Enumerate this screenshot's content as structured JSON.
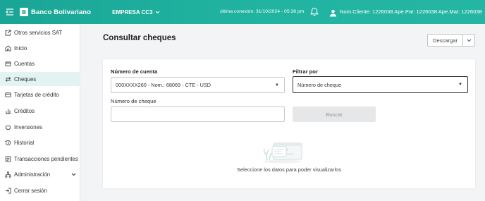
{
  "header": {
    "brand_initial": "B",
    "brand": "Banco Bolivariano",
    "company": "EMPRESA CC3",
    "last_connection": "última conexión: 31/10/2024 - 05:38 pm",
    "user_info": "Nom.Cliente: 1226038 Ape.Pat: 1226038 Ape.Mat: 1226038",
    "colors": {
      "accent": "#1aa596",
      "active_bg": "#e3f3f1"
    }
  },
  "sidebar": {
    "items": [
      {
        "label": "Otros servicios SAT",
        "icon": "external-link-icon"
      },
      {
        "label": "Inicio",
        "icon": "home-icon"
      },
      {
        "label": "Cuentas",
        "icon": "wallet-icon"
      },
      {
        "label": "Cheques",
        "icon": "transfer-arrows-icon",
        "active": true
      },
      {
        "label": "Tarjetas de crédito",
        "icon": "credit-card-icon"
      },
      {
        "label": "Créditos",
        "icon": "bar-chart-icon"
      },
      {
        "label": "Inversiones",
        "icon": "piggy-bank-icon"
      },
      {
        "label": "Historial",
        "icon": "history-icon"
      },
      {
        "label": "Transacciones pendientes",
        "icon": "pending-list-icon"
      },
      {
        "label": "Administración",
        "icon": "hierarchy-icon",
        "expandable": true
      },
      {
        "label": "Cerrar sesión",
        "icon": "logout-icon"
      }
    ]
  },
  "main": {
    "title": "Consultar cheques",
    "download_label": "Descargar",
    "account_label": "Número de cuenta",
    "account_value": "000XXXX260 - Nom.: 68069 - CTE - USD",
    "filter_label": "Filtrar por",
    "filter_value": "Número de cheque",
    "check_number_label": "Número de cheque",
    "check_number_value": "",
    "search_label": "Buscar",
    "empty_message": "Seleccione los datos para poder visualizarlos"
  }
}
